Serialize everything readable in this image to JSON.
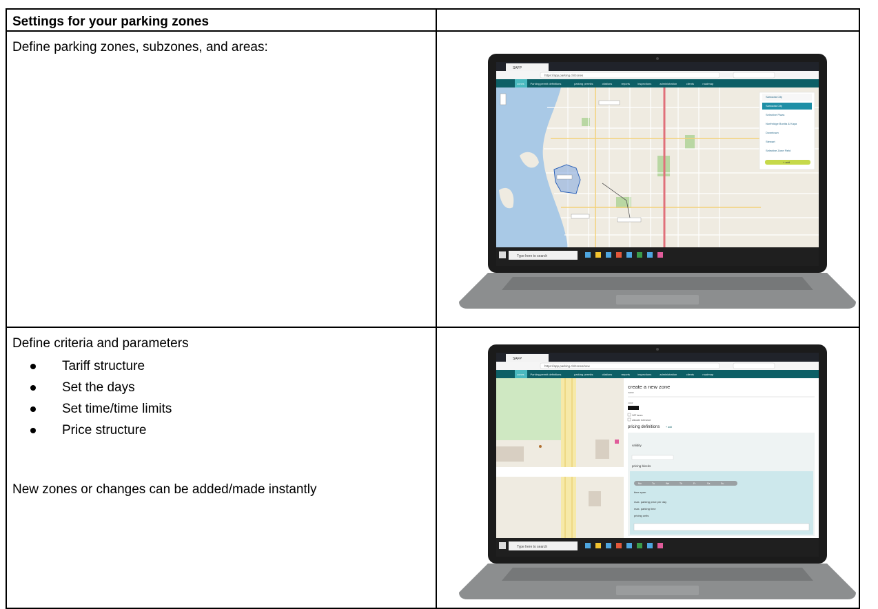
{
  "table": {
    "header_left": "Settings for your parking zones",
    "header_right": "",
    "row1_text": "Define parking zones, subzones, and areas:",
    "row2_title": "Define criteria and parameters",
    "row2_bullets": [
      "Tariff structure",
      "Set the days",
      "Set time/time limits",
      "Price structure"
    ],
    "row2_note": "New zones or changes can be added/made instantly"
  },
  "screenshot1": {
    "browser_url": "https://app.parking.ch/zones",
    "app_nav": [
      "zones",
      "Parking permit definitions",
      "parking permits",
      "citations",
      "reports",
      "inspections",
      "administration",
      "clients",
      "roadmap"
    ],
    "zone_list": [
      "Sarasota City",
      "Sarasota City",
      "Selective Plaza",
      "Northridge Bonita & Kaya",
      "Downtown",
      "Stewart",
      "Selective Zone Field"
    ],
    "add_button": "+ add",
    "taskbar_search": "Type here to search"
  },
  "screenshot2": {
    "browser_url": "https://app.parking.ch/zones/new",
    "app_nav": [
      "zones",
      "Parking permit definitions",
      "parking permits",
      "citations",
      "reports",
      "inspections",
      "administration",
      "clients",
      "roadmap"
    ],
    "form_title": "create a new zone",
    "name_label": "name",
    "color_label": "color",
    "check_vat": "VAT taxes",
    "check_tolerance": "allocate tolerance",
    "pricing_definitions": "pricing definitions",
    "add_label": "+ add",
    "validity_label": "validity",
    "pricing_blocks_label": "pricing blocks",
    "weekdays": [
      "Mo",
      "Tu",
      "We",
      "Th",
      "Fr",
      "Sa",
      "Su"
    ],
    "time_span_label": "time span",
    "max_price_label": "max. parking price per day",
    "max_time_label": "max. parking time",
    "pricing_units_label": "pricing units",
    "taskbar_search": "Type here to search"
  }
}
